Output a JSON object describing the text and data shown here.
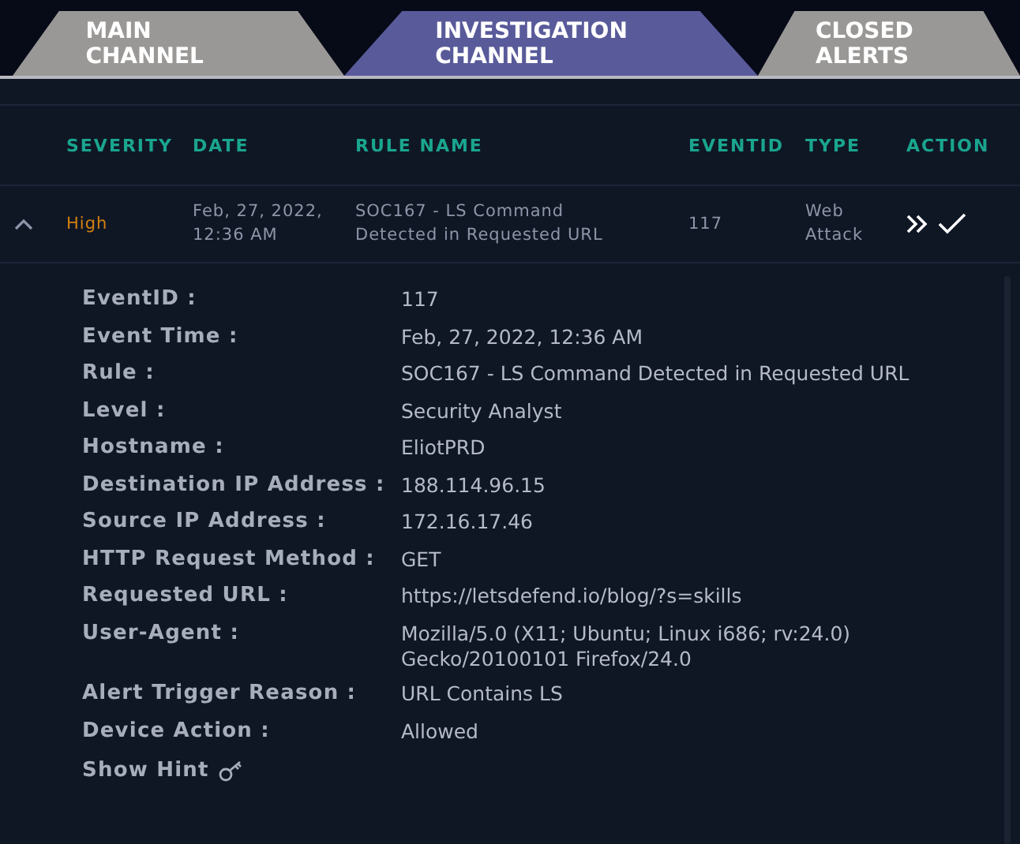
{
  "tabs": [
    {
      "label": "MAIN CHANNEL",
      "selected": false
    },
    {
      "label": "INVESTIGATION CHANNEL",
      "selected": true
    },
    {
      "label": "CLOSED ALERTS",
      "selected": false
    }
  ],
  "table": {
    "columns": [
      "SEVERITY",
      "DATE",
      "RULE NAME",
      "EVENTID",
      "TYPE",
      "ACTION"
    ],
    "row": {
      "expanded": true,
      "severity": "High",
      "date": "Feb, 27, 2022, 12:36 AM",
      "rule": "SOC167 - LS Command Detected in Requested URL",
      "eventid": "117",
      "type": "Web Attack"
    }
  },
  "details": [
    {
      "label": "EventID :",
      "value": "117"
    },
    {
      "label": "Event Time :",
      "value": "Feb, 27, 2022, 12:36 AM"
    },
    {
      "label": "Rule :",
      "value": "SOC167 - LS Command Detected in Requested URL"
    },
    {
      "label": "Level :",
      "value": "Security Analyst"
    },
    {
      "label": "Hostname :",
      "value": "EliotPRD"
    },
    {
      "label": "Destination IP Address :",
      "value": "188.114.96.15"
    },
    {
      "label": "Source IP Address :",
      "value": "172.16.17.46"
    },
    {
      "label": "HTTP Request Method :",
      "value": "GET"
    },
    {
      "label": "Requested URL :",
      "value": "https://letsdefend.io/blog/?s=skills"
    },
    {
      "label": "User-Agent :",
      "value": "Mozilla/5.0 (X11; Ubuntu; Linux i686; rv:24.0) Gecko/20100101 Firefox/24.0"
    },
    {
      "label": "Alert Trigger Reason :",
      "value": "URL Contains LS"
    },
    {
      "label": "Device Action :",
      "value": "Allowed"
    }
  ],
  "hint": "Show Hint"
}
